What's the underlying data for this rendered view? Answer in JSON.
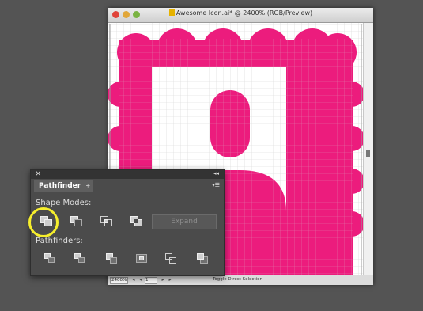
{
  "window": {
    "title": "Awesome Icon.ai* @ 2400% (RGB/Preview)",
    "status": {
      "zoom": "2400%",
      "page": "1",
      "text": "Toggle Direct Selection"
    }
  },
  "artwork": {
    "fill_color": "#ec1c7d",
    "grid_color": "#d6d6d6"
  },
  "pathfinder": {
    "tab_label": "Pathfinder",
    "shape_modes_label": "Shape Modes:",
    "pathfinders_label": "Pathfinders:",
    "expand_label": "Expand",
    "shape_modes": [
      "unite-icon",
      "minus-front-icon",
      "intersect-icon",
      "exclude-icon"
    ],
    "pathfinder_ops": [
      "divide-icon",
      "trim-icon",
      "merge-icon",
      "crop-icon",
      "outline-icon",
      "minus-back-icon"
    ]
  },
  "highlight_color": "#f6ee2c"
}
